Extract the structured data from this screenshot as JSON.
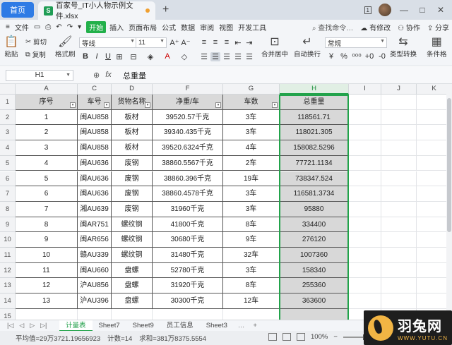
{
  "titlebar": {
    "home_label": "首页",
    "doc_title": "百家号_IT小人物示例文件.xlsx",
    "doc_icon": "S",
    "new_tab": "+",
    "badge": "1",
    "min": "—",
    "max": "□",
    "close": "✕"
  },
  "menu": {
    "file": "文件",
    "items": [
      "开始",
      "插入",
      "页面布局",
      "公式",
      "数据",
      "审阅",
      "视图",
      "开发工具"
    ],
    "search": "查找命令…",
    "modify": "有修改",
    "collab": "协作",
    "share": "分享"
  },
  "ribbon": {
    "paste": "粘贴",
    "cut": "剪切",
    "copy": "复制",
    "format_painter": "格式刷",
    "font_name": "等线",
    "font_size": "11",
    "merge_center": "合并居中",
    "wrap_text": "自动换行",
    "number_format": "常规",
    "type_convert": "类型转换",
    "conditional_format": "条件格"
  },
  "formula_bar": {
    "name_box": "H1",
    "fx": "fx",
    "content": "总重量"
  },
  "columns": [
    "A",
    "C",
    "D",
    "F",
    "G",
    "H",
    "I",
    "J",
    "K"
  ],
  "headers": [
    "序号",
    "车号",
    "货物名称",
    "净重/车",
    "车数",
    "总重量"
  ],
  "rows": [
    [
      "1",
      "闽AU858",
      "板材",
      "39520.57千克",
      "3车",
      "118561.71"
    ],
    [
      "2",
      "闽AU858",
      "板材",
      "39340.435千克",
      "3车",
      "118021.305"
    ],
    [
      "3",
      "闽AU858",
      "板材",
      "39520.6324千克",
      "4车",
      "158082.5296"
    ],
    [
      "4",
      "闽AU636",
      "废钢",
      "38860.5567千克",
      "2车",
      "77721.1134"
    ],
    [
      "5",
      "闽AU636",
      "废钢",
      "38860.396千克",
      "19车",
      "738347.524"
    ],
    [
      "6",
      "闽AU636",
      "废钢",
      "38860.4578千克",
      "3车",
      "116581.3734"
    ],
    [
      "7",
      "湘AU639",
      "废钢",
      "31960千克",
      "3车",
      "95880"
    ],
    [
      "8",
      "闽AR751",
      "螺纹钢",
      "41800千克",
      "8车",
      "334400"
    ],
    [
      "9",
      "闽AR656",
      "螺纹钢",
      "30680千克",
      "9车",
      "276120"
    ],
    [
      "10",
      "赣AU339",
      "螺纹钢",
      "31480千克",
      "32车",
      "1007360"
    ],
    [
      "11",
      "闽AU660",
      "盘螺",
      "52780千克",
      "3车",
      "158340"
    ],
    [
      "12",
      "沪AU856",
      "盘螺",
      "31920千克",
      "8车",
      "255360"
    ],
    [
      "13",
      "沪AU396",
      "盘螺",
      "30300千克",
      "12车",
      "363600"
    ]
  ],
  "row_numbers": [
    "1",
    "2",
    "3",
    "4",
    "5",
    "6",
    "7",
    "8",
    "9",
    "10",
    "11",
    "12",
    "13",
    "14",
    "15"
  ],
  "sheets": [
    "计量表",
    "Sheet7",
    "Sheet9",
    "员工信息",
    "Sheet3"
  ],
  "active_sheet": "计量表",
  "sheet_more": "…",
  "sheet_add": "+",
  "status": {
    "average": "平均值=29万3721.19656923",
    "count": "计数=14",
    "sum": "求和=381万8375.5554",
    "zoom": "100%"
  },
  "watermark": {
    "brand": "羽兔网",
    "url": "WWW.YUTU.CN"
  },
  "colors": {
    "accent_green": "#22a34b",
    "home_blue": "#2e7be5",
    "header_gray": "#d9d9d9"
  }
}
